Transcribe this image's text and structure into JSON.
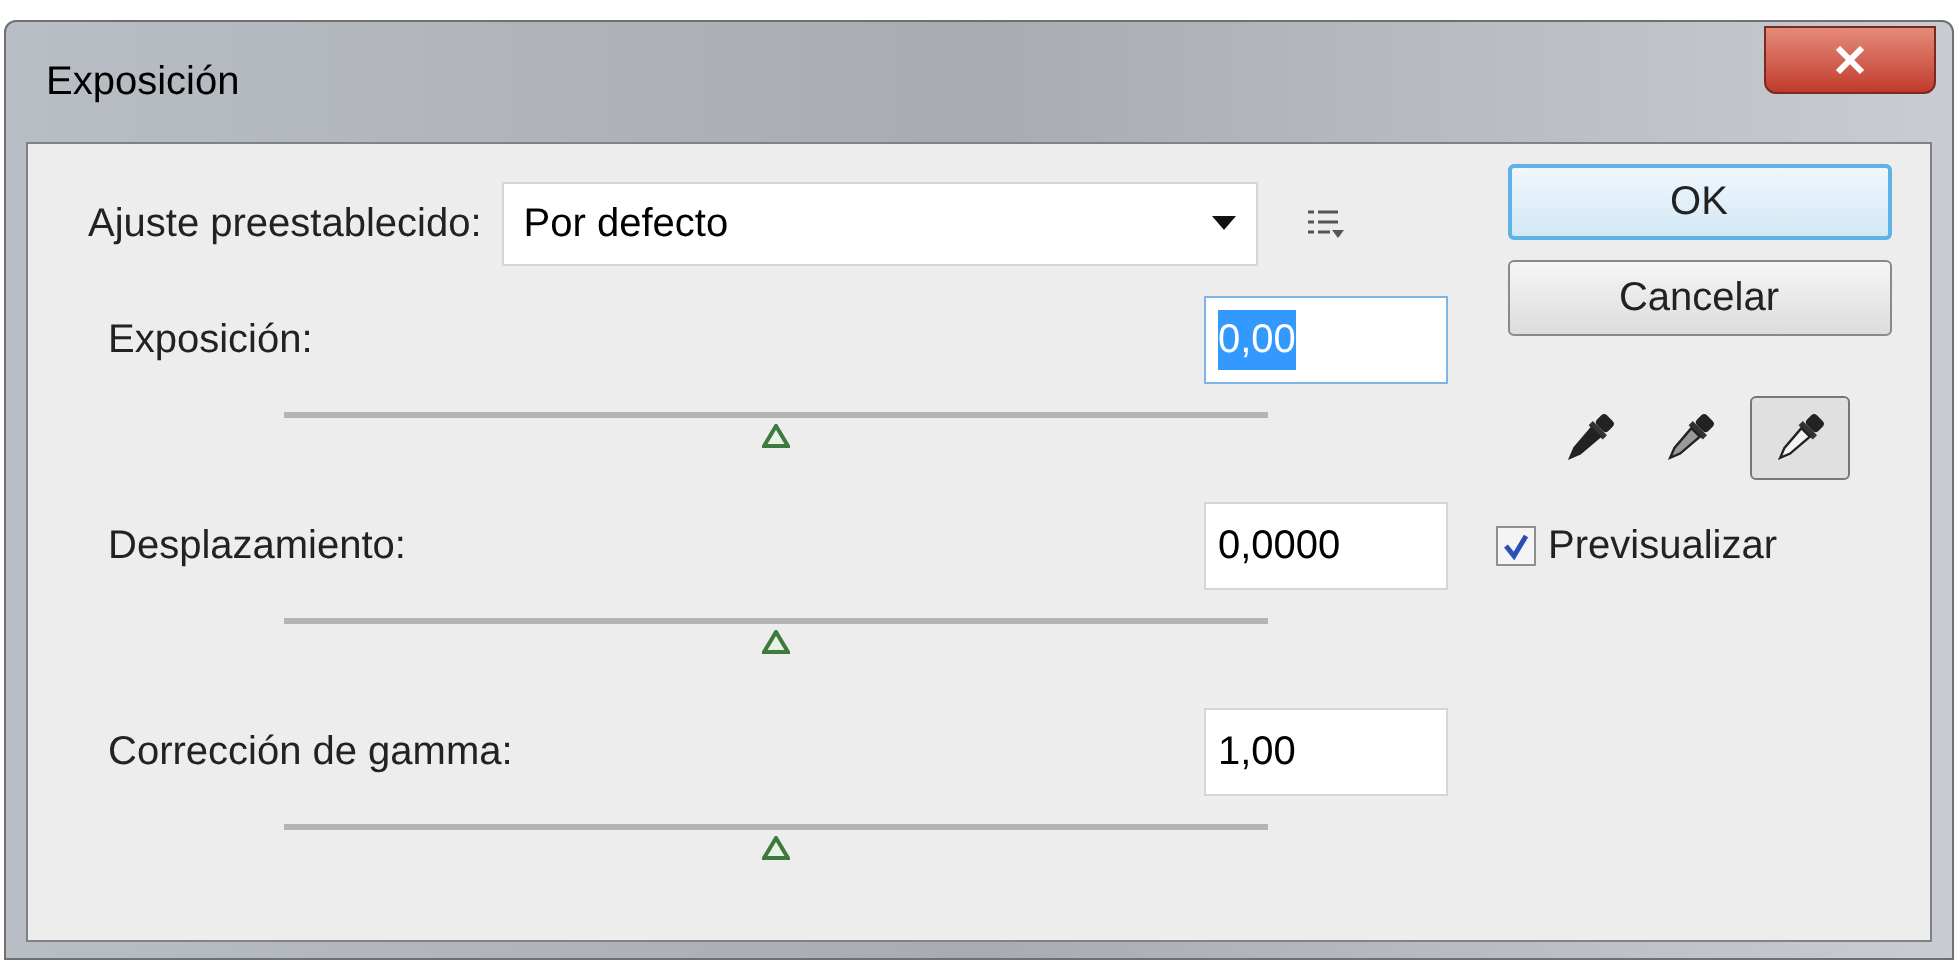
{
  "window": {
    "title": "Exposición"
  },
  "preset": {
    "label": "Ajuste preestablecido:",
    "value": "Por defecto"
  },
  "controls": [
    {
      "label": "Exposición:",
      "value": "0,00",
      "selected": true,
      "level": 0.5
    },
    {
      "label": "Desplazamiento:",
      "value": "0,0000",
      "selected": false,
      "level": 0.5
    },
    {
      "label": "Corrección de gamma:",
      "value": "1,00",
      "selected": false,
      "level": 0.5
    }
  ],
  "buttons": [
    {
      "label": "OK",
      "selected": true
    },
    {
      "label": "Cancelar",
      "selected": false
    }
  ],
  "eyedroppers": [
    {
      "kind": "black",
      "selected": false
    },
    {
      "kind": "gray",
      "selected": false
    },
    {
      "kind": "white",
      "selected": true
    }
  ],
  "preview": {
    "label": "Previsualizar",
    "checked": true
  }
}
